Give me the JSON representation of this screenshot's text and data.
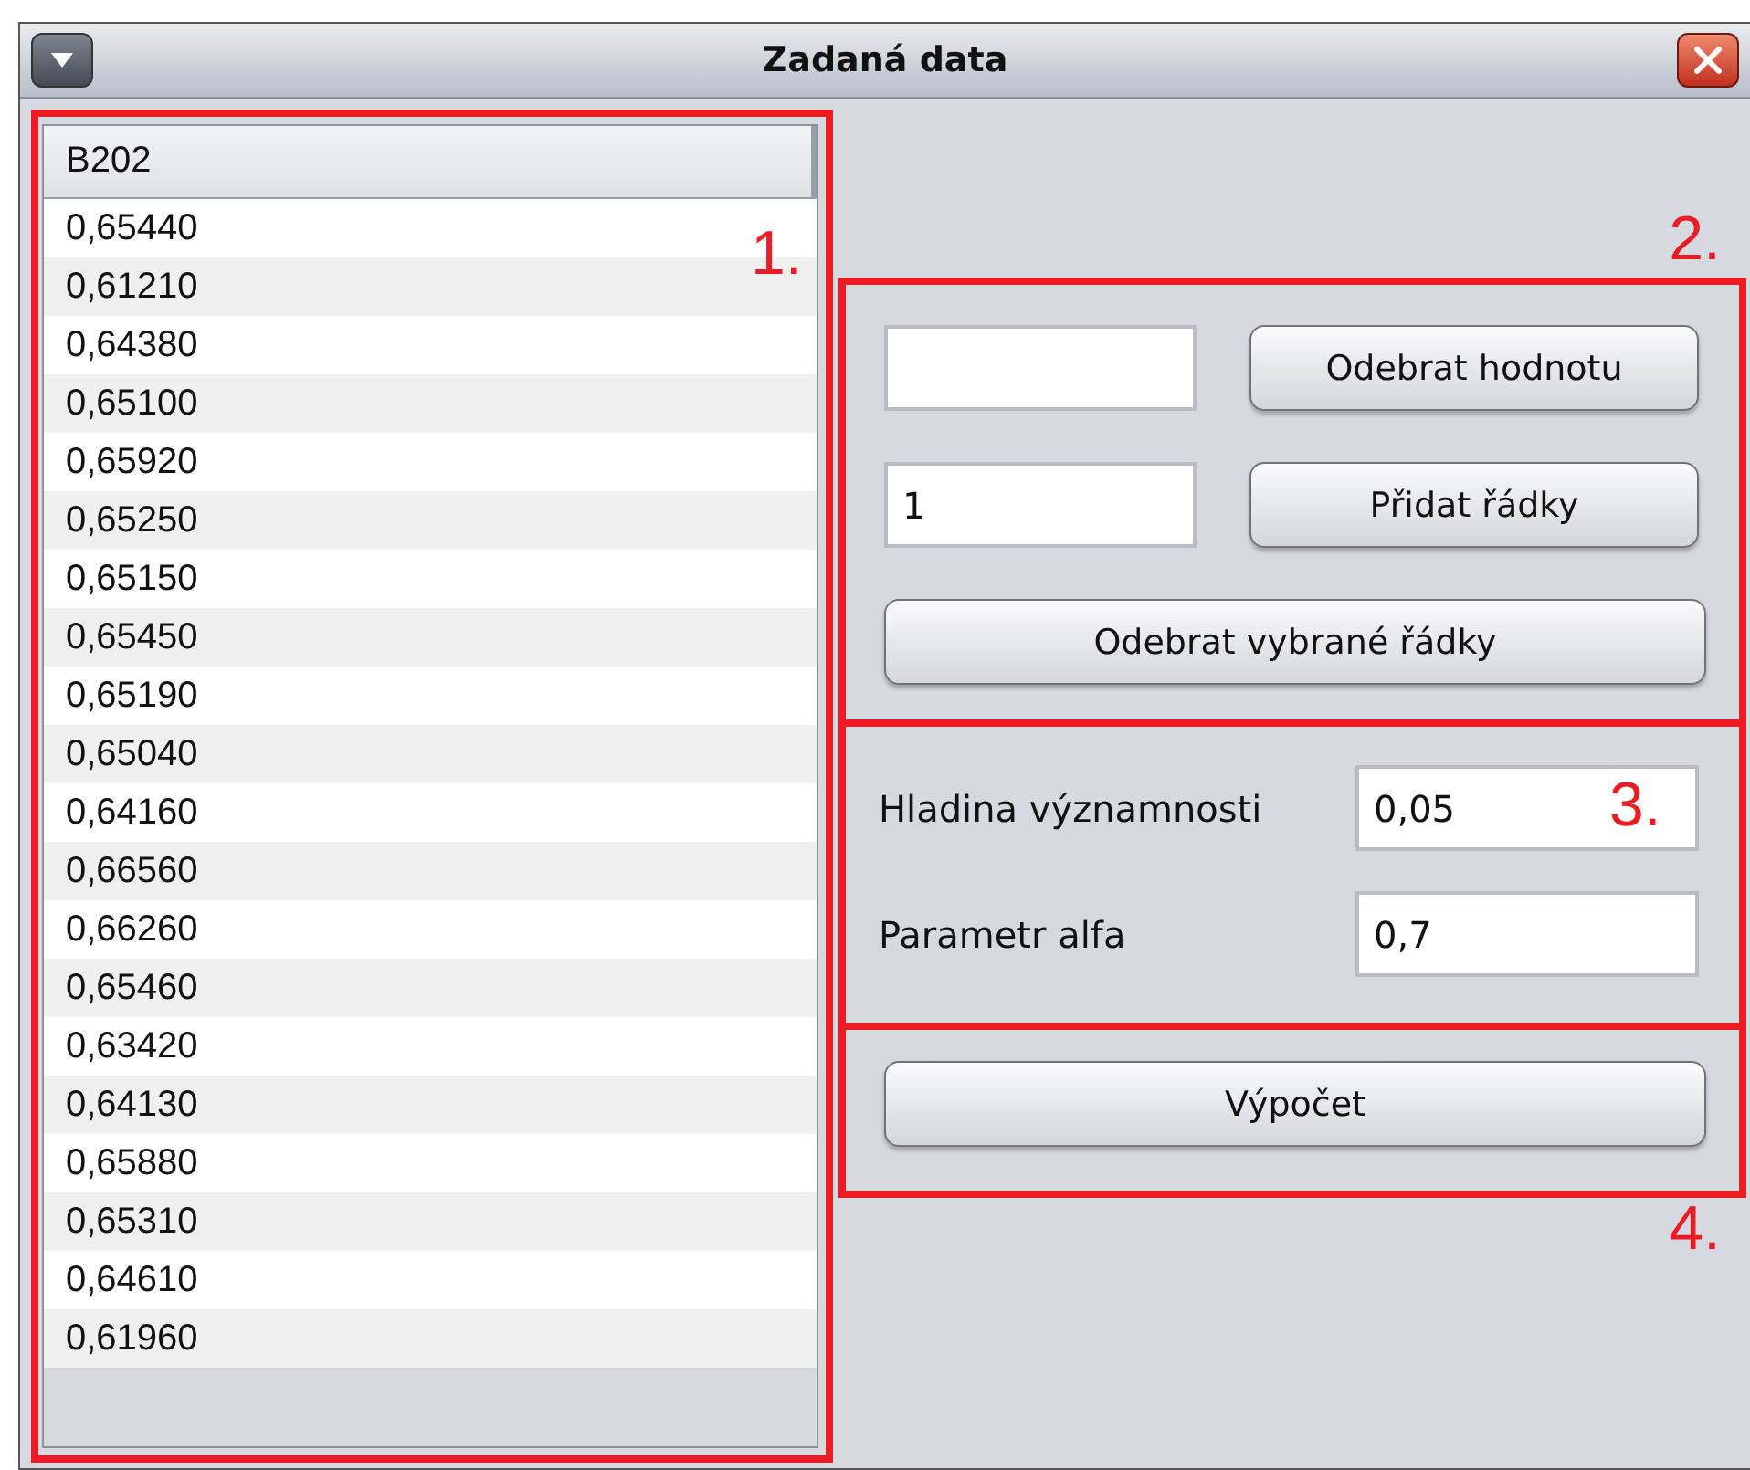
{
  "window": {
    "title": "Zadaná data"
  },
  "table": {
    "columns": [
      "B202"
    ],
    "rows": [
      "0,65440",
      "0,61210",
      "0,64380",
      "0,65100",
      "0,65920",
      "0,65250",
      "0,65150",
      "0,65450",
      "0,65190",
      "0,65040",
      "0,64160",
      "0,66560",
      "0,66260",
      "0,65460",
      "0,63420",
      "0,64130",
      "0,65880",
      "0,65310",
      "0,64610",
      "0,61960"
    ]
  },
  "remove_value": {
    "button": "Odebrat hodnotu"
  },
  "add_rows": {
    "value": "1",
    "button": "Přidat řádky"
  },
  "remove_selected_button": "Odebrat vybrané řádky",
  "parameters": [
    {
      "label": "Hladina významnosti",
      "value": "0,05"
    },
    {
      "label": "Parametr alfa",
      "value": "0,7"
    }
  ],
  "compute_button": "Výpočet",
  "annotations": [
    "1.",
    "2.",
    "3.",
    "4."
  ]
}
